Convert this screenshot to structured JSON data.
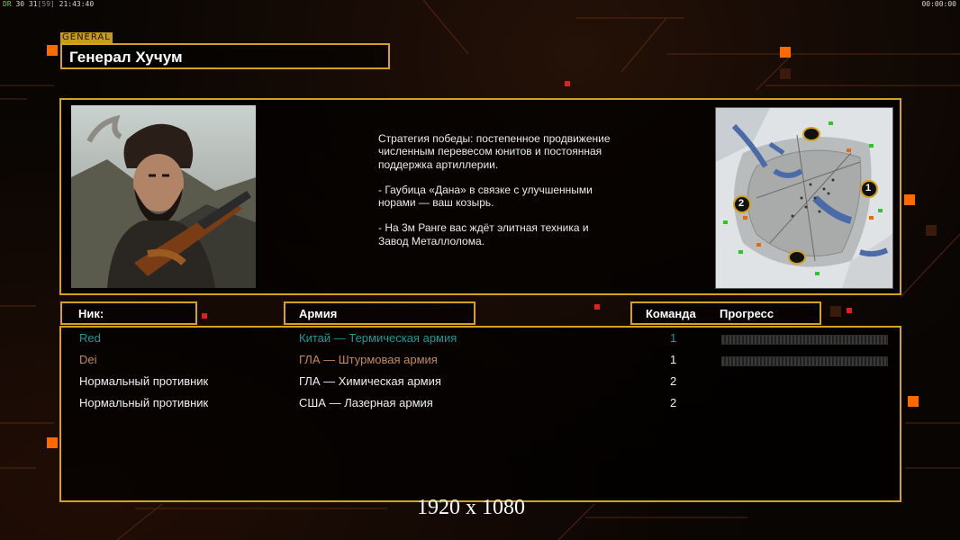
{
  "hud": {
    "top_left_prefix": "DR",
    "top_left_stats": "30 31",
    "top_left_fps": "[59]",
    "top_left_time": "21:43:40",
    "top_right_timer": "00:00:00"
  },
  "general": {
    "tag": "GENERAL",
    "name": "Генерал Хучум"
  },
  "strategy": {
    "p1": "Стратегия победы: постепенное продвижение численным перевесом юнитов и постоянная поддержка артиллерии.",
    "p2": "- Гаубица «Дана» в связке с улучшенными норами — ваш козырь.",
    "p3": "- На 3м Ранге вас ждёт элитная техника и Завод Металлолома."
  },
  "minimap": {
    "start_labels": [
      "1",
      "2"
    ]
  },
  "columns": {
    "nick": "Ник:",
    "army": "Армия",
    "team": "Команда",
    "progress": "Прогресс"
  },
  "players": [
    {
      "nick": "Red",
      "army": "Китай — Термическая армия",
      "team": "1",
      "color": "#1a9a9a",
      "show_progress": true
    },
    {
      "nick": "Dei",
      "army": "ГЛА — Штурмовая армия",
      "team": "1",
      "color": "#c48a5a",
      "show_progress": true
    },
    {
      "nick": "Нормальный противник",
      "army": "ГЛА — Химическая армия",
      "team": "2",
      "color": "#f0f0f0",
      "show_progress": false
    },
    {
      "nick": "Нормальный противник",
      "army": "США — Лазерная армия",
      "team": "2",
      "color": "#f0f0f0",
      "show_progress": false
    }
  ],
  "resolution_label": "1920 x 1080",
  "colors": {
    "frame_gold": "#d4a21e",
    "accent_orange": "#ff6a00",
    "player_red": "#1a9a9a",
    "player_dei": "#c48a5a"
  }
}
